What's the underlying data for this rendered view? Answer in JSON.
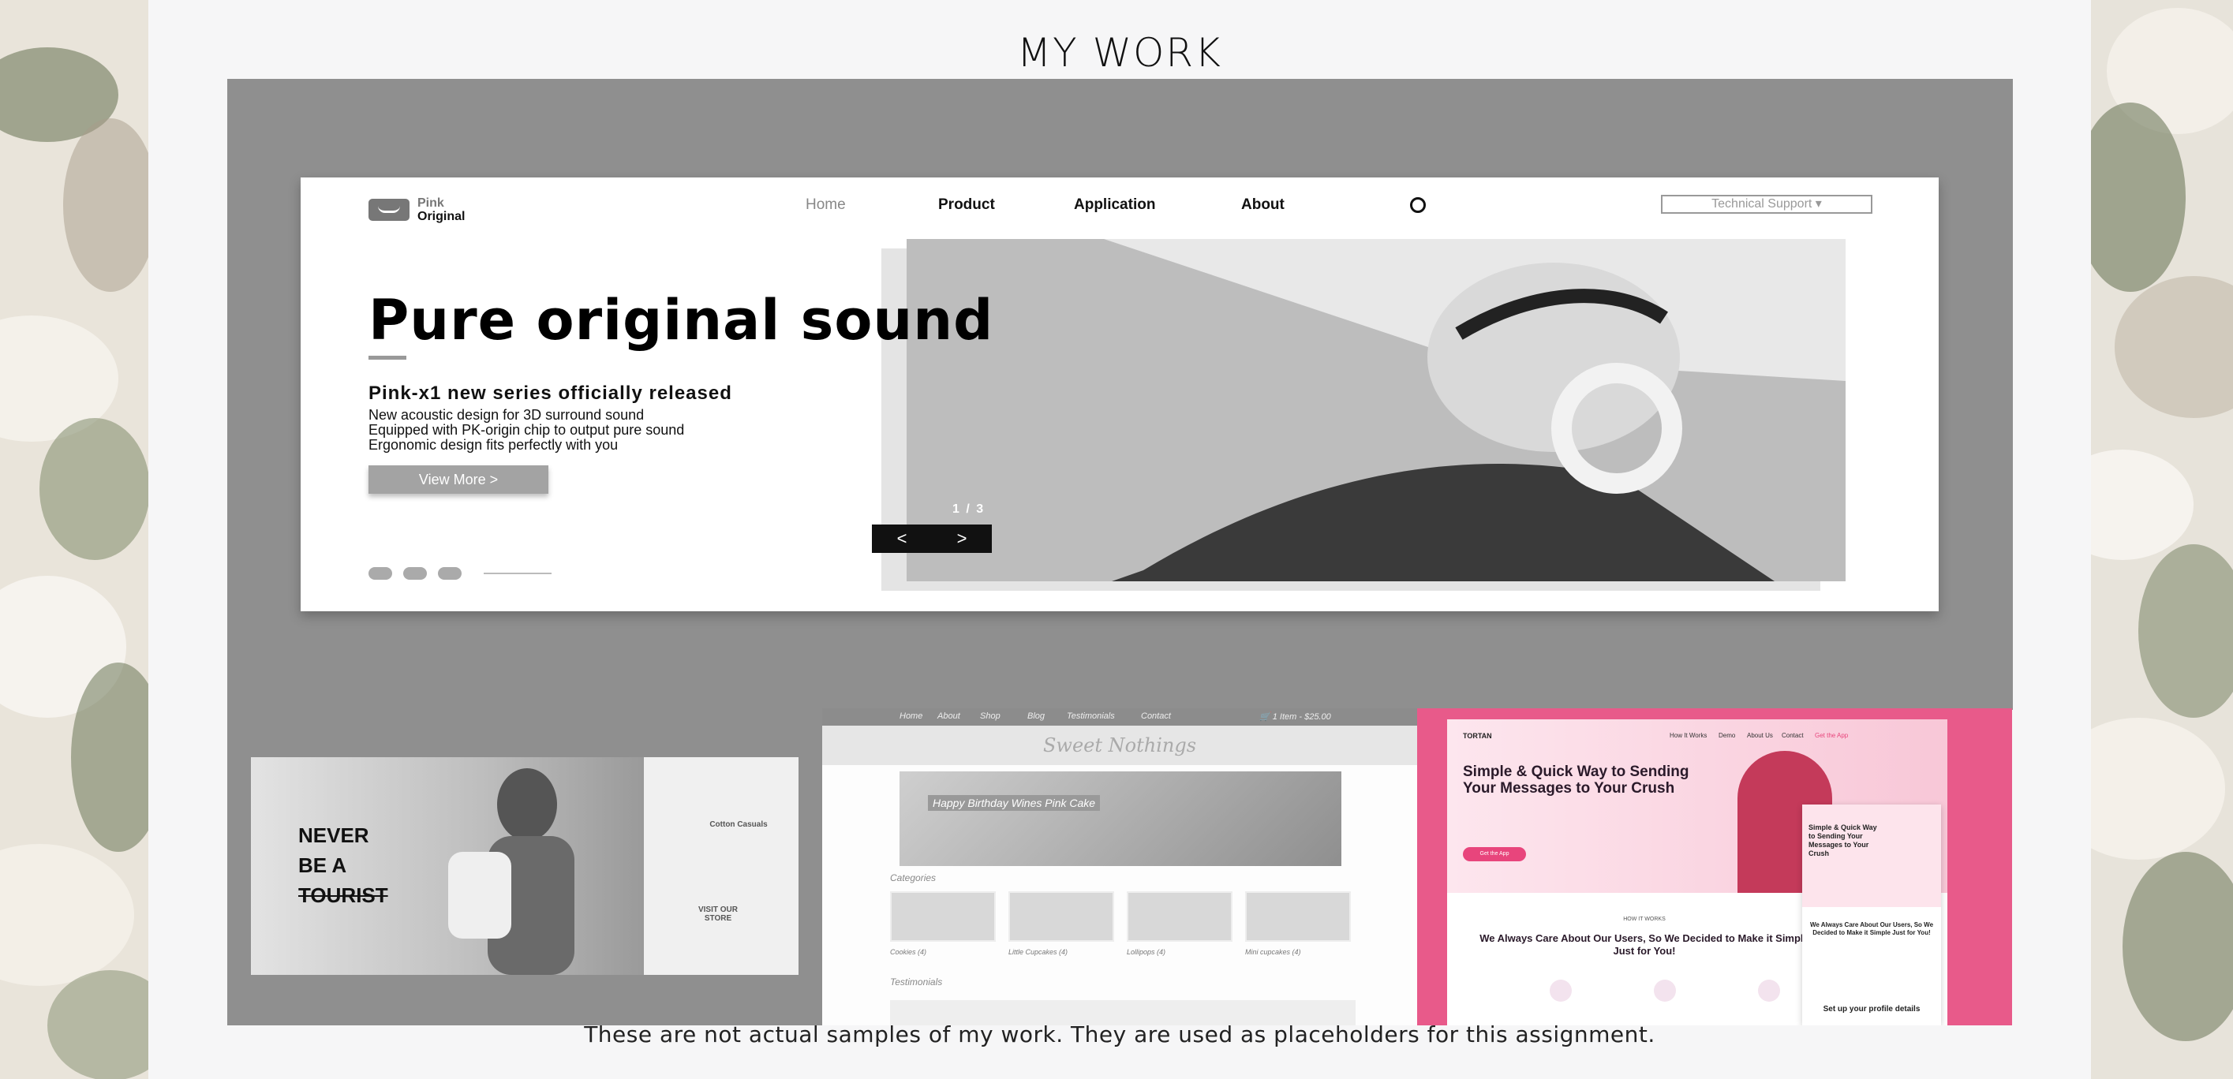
{
  "page": {
    "title": "MY WORK",
    "caption": "These are not actual samples of my work. They are used as placeholders for this assignment."
  },
  "colors": {
    "page_background": "#f6f6f7",
    "gallery_gray": "#8f8f8f",
    "thumb3_accent": "#e85a8a",
    "side_floral": "#e9e4da"
  },
  "featured_shot": {
    "logo_line1": "Pink",
    "logo_line2": "Original",
    "nav": [
      "Home",
      "Product",
      "Application",
      "About"
    ],
    "search_icon": "search-icon",
    "support_label": "Technical Support ▾",
    "headline": "Pure original sound",
    "subheadline": "Pink-x1 new series officially released",
    "features": [
      "New acoustic design for 3D surround sound",
      "Equipped with PK-origin chip to output pure sound",
      "Ergonomic design fits perfectly with you"
    ],
    "button_label": "View More >",
    "slide_counter": "1 / 3",
    "prev_arrow": "<",
    "next_arrow": ">",
    "social_icons": [
      "instagram-icon",
      "facebook-icon",
      "twitter-icon"
    ]
  },
  "thumbnails": {
    "t1": {
      "headline": [
        "NEVER",
        "BE A",
        "TOURIST"
      ],
      "shop_title": "Cotton Casuals",
      "store_label": "VISIT OUR STORE"
    },
    "t2": {
      "nav": [
        "Home",
        "About",
        "Shop",
        "Blog",
        "Testimonials",
        "Contact"
      ],
      "cart": "🛒 1 Item - $25.00",
      "store_name": "Sweet Nothings",
      "banner_text": "Happy Birthday Wines Pink Cake",
      "categories_label": "Categories",
      "categories": [
        "Cookies (4)",
        "Little Cupcakes (4)",
        "Lollipops (4)",
        "Mini cupcakes (4)"
      ],
      "testimonials_label": "Testimonials"
    },
    "t3": {
      "brand": "TORTAN",
      "menu": [
        "How It Works",
        "Demo",
        "About Us",
        "Contact",
        "Get the App"
      ],
      "hero_headline": "Simple & Quick Way to Sending Your Messages to Your Crush",
      "cta": "Get the App",
      "how_label": "HOW IT WORKS",
      "section_headline": "We Always Care About Our Users, So We Decided to Make it Simple Just for You!",
      "phone_headline": "Simple & Quick Way to Sending Your Messages to Your Crush",
      "phone_section": "We Always Care About Our Users, So We Decided to Make it Simple Just for You!",
      "phone_step": "Set up your profile details"
    }
  }
}
